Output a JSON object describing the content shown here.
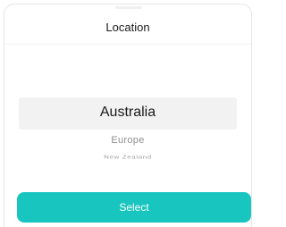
{
  "sheet": {
    "title": "Location"
  },
  "picker": {
    "options": [
      "Australia",
      "Europe",
      "New Zealand"
    ],
    "selected": "Australia"
  },
  "actions": {
    "select_label": "Select"
  },
  "colors": {
    "accent": "#18c5bf",
    "selected_band": "#f2f2f2"
  }
}
